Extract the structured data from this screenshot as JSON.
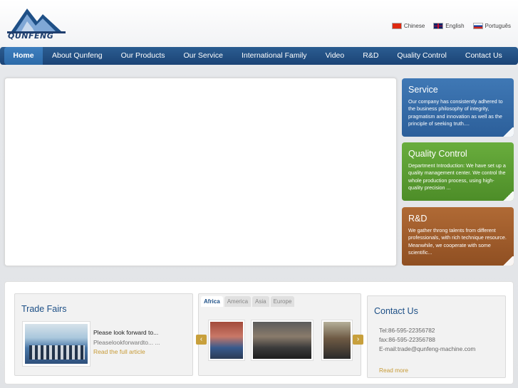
{
  "brand": {
    "logo_text": "QUNFENG"
  },
  "languages": [
    {
      "label": "Chinese",
      "flag": "china-flag-icon"
    },
    {
      "label": "English",
      "flag": "uk-flag-icon"
    },
    {
      "label": "Português",
      "flag": "russia-flag-icon"
    }
  ],
  "nav": {
    "items": [
      "Home",
      "About Qunfeng",
      "Our Products",
      "Our Service",
      "International Family",
      "Video",
      "R&D",
      "Quality Control",
      "Contact Us"
    ],
    "active": "Home"
  },
  "sideboxes": {
    "service": {
      "title": "Service",
      "text": "Our company has consistently adhered to the business philosophy of integrity, pragmatism and innovation as well as the principle of seeking truth....",
      "color": "#3a72ae"
    },
    "quality": {
      "title": "Quality Control",
      "text": "Department Introduction: We have set up a quality management center. We control the whole production process, using high-quality precision ...",
      "color": "#5c9f33"
    },
    "rd": {
      "title": "R&D",
      "text": "We gather throng talents from different professionals, with rich technique resource. Meanwhile, we cooperate with some scientific...",
      "color": "#a0602d"
    }
  },
  "trade": {
    "title": "Trade Fairs",
    "item_title": "Please look forward to...",
    "item_desc": "Pleaselookforwardto... ...",
    "link": "Read the full article"
  },
  "family": {
    "tabs": [
      "Africa",
      "America",
      "Asia",
      "Europe"
    ],
    "active_tab": "Africa",
    "prev": "‹",
    "next": "›"
  },
  "contact": {
    "title": "Contact Us",
    "tel": "Tel:86-595-22356782",
    "fax": "fax:86-595-22356788",
    "email": "E-mail:trade@qunfeng-machine.com",
    "more": "Read more"
  },
  "colors": {
    "nav": "#1f4c80",
    "accent_gold": "#c79a35",
    "heading_blue": "#1c4f86"
  }
}
